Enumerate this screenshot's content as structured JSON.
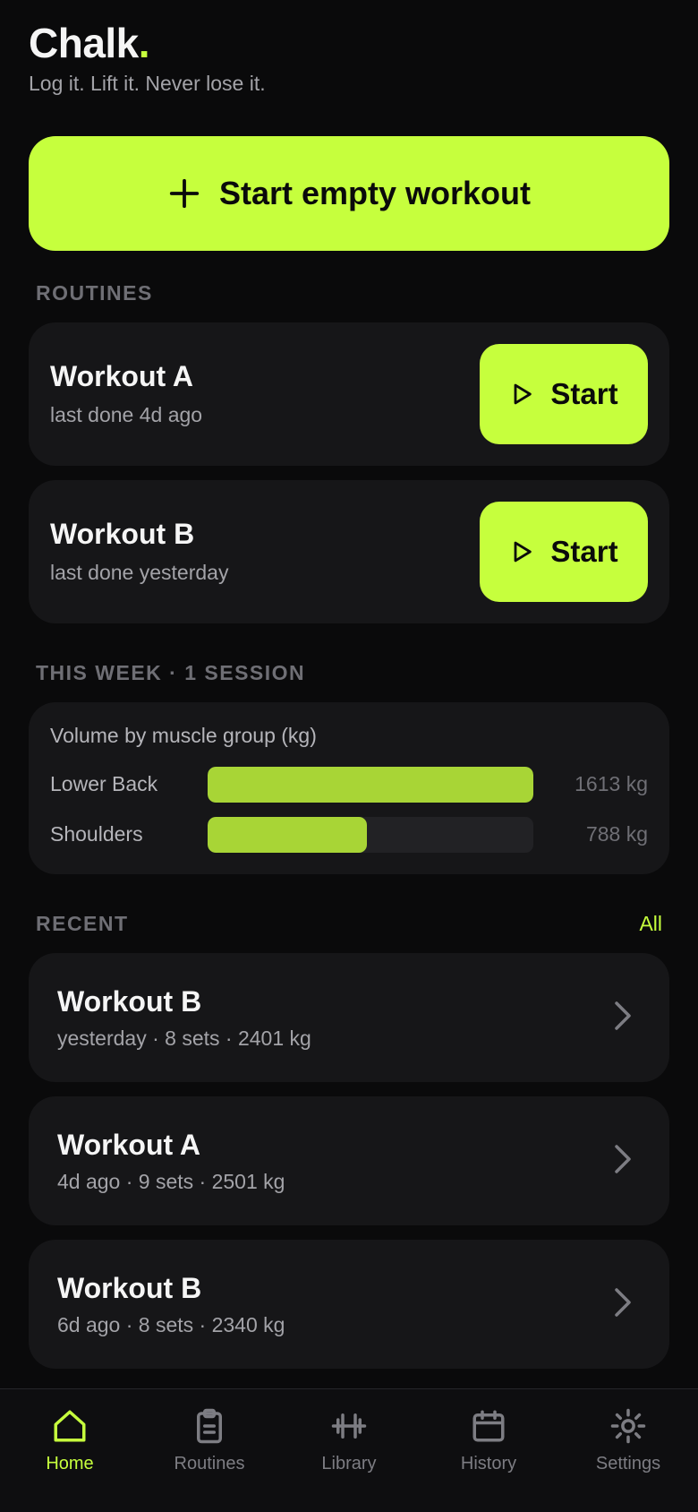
{
  "app": {
    "name": "Chalk",
    "name_dot": ".",
    "tagline": "Log it. Lift it. Never lose it."
  },
  "cta": {
    "label": "Start empty workout"
  },
  "routines": {
    "section_label": "ROUTINES",
    "items": [
      {
        "title": "Workout A",
        "subtitle": "last done 4d ago",
        "button_label": "Start"
      },
      {
        "title": "Workout B",
        "subtitle": "last done yesterday",
        "button_label": "Start"
      }
    ]
  },
  "this_week": {
    "section_label": "THIS WEEK · 1 SESSION",
    "chart_title": "Volume by muscle group (kg)",
    "rows": [
      {
        "label": "Lower Back",
        "value_text": "1613 kg"
      },
      {
        "label": "Shoulders",
        "value_text": "788 kg"
      }
    ]
  },
  "chart_data": {
    "type": "bar",
    "orientation": "horizontal",
    "title": "Volume by muscle group (kg)",
    "categories": [
      "Lower Back",
      "Shoulders"
    ],
    "values": [
      1613,
      788
    ],
    "xlim": [
      0,
      1613
    ],
    "grid": false
  },
  "recent": {
    "section_label": "RECENT",
    "all_label": "All",
    "items": [
      {
        "title": "Workout B",
        "subtitle": "yesterday · 8 sets · 2401 kg"
      },
      {
        "title": "Workout A",
        "subtitle": "4d ago · 9 sets · 2501 kg"
      },
      {
        "title": "Workout B",
        "subtitle": "6d ago · 8 sets · 2340 kg"
      }
    ]
  },
  "tabs": [
    {
      "label": "Home",
      "icon": "home-icon",
      "active": true
    },
    {
      "label": "Routines",
      "icon": "clipboard-icon",
      "active": false
    },
    {
      "label": "Library",
      "icon": "dumbbell-icon",
      "active": false
    },
    {
      "label": "History",
      "icon": "calendar-icon",
      "active": false
    },
    {
      "label": "Settings",
      "icon": "gear-icon",
      "active": false
    }
  ],
  "colors": {
    "accent": "#c6ff3d",
    "bar_fill": "#a8d536",
    "background": "#0a0a0b",
    "card": "#161618"
  }
}
